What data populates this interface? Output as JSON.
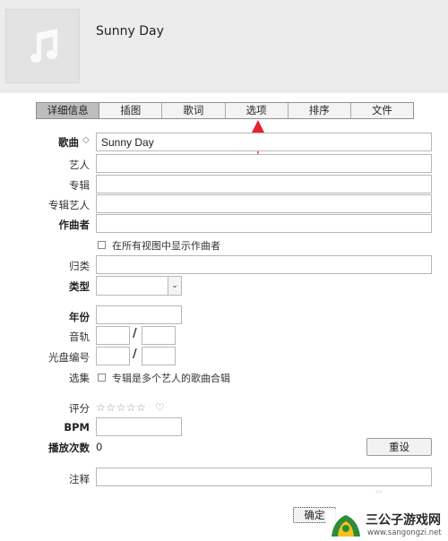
{
  "header": {
    "song_title": "Sunny Day",
    "artwork_icon": "music-note-icon"
  },
  "tabs": [
    {
      "label": "详细信息",
      "active": true
    },
    {
      "label": "插图"
    },
    {
      "label": "歌词"
    },
    {
      "label": "选项"
    },
    {
      "label": "排序"
    },
    {
      "label": "文件"
    }
  ],
  "fields": {
    "song_label": "歌曲",
    "song_value": "Sunny Day",
    "artist_label": "艺人",
    "artist_value": "",
    "album_label": "专辑",
    "album_value": "",
    "album_artist_label": "专辑艺人",
    "album_artist_value": "",
    "composer_label": "作曲者",
    "composer_value": "",
    "show_composer_label": "在所有视图中显示作曲者",
    "grouping_label": "归类",
    "grouping_value": "",
    "genre_label": "类型",
    "genre_value": "",
    "year_label": "年份",
    "year_value": "",
    "track_label": "音轨",
    "track_sep": "/",
    "disc_label": "光盘编号",
    "disc_sep": "/",
    "compilation_label": "选集",
    "compilation_text": "专辑是多个艺人的歌曲合辑",
    "rating_label": "评分",
    "rating_stars": "☆☆☆☆☆",
    "heart": "♡",
    "bpm_label": "BPM",
    "bpm_value": "",
    "play_count_label": "播放次数",
    "play_count_value": "0",
    "reset_label": "重设",
    "comments_label": "注释",
    "comments_value": ""
  },
  "footer": {
    "ok_label": "确定",
    "faint_text": "ᐡᐡ"
  },
  "watermark": {
    "title": "三公子游戏网",
    "url": "www.sangongzi.net"
  },
  "colors": {
    "arrow": "#e8202a",
    "active_tab": "#bdbdbd",
    "header_bg": "#ececec"
  }
}
